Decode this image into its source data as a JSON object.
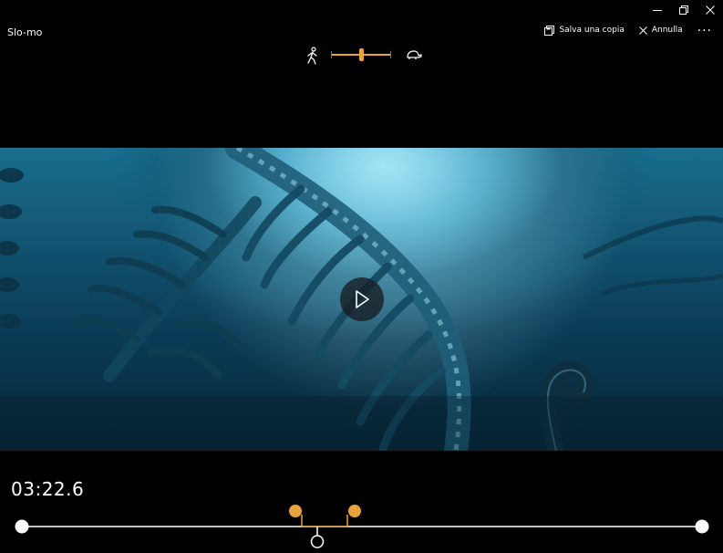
{
  "window": {
    "title": "Slo-mo",
    "controls": {
      "minimize": "minimize-icon",
      "restore": "restore-icon",
      "close": "close-icon"
    }
  },
  "toolbar": {
    "save_copy_label": "Salva una copia",
    "cancel_label": "Annulla",
    "more_label": "..."
  },
  "speed_slider": {
    "left_icon": "walking-person-icon",
    "right_icon": "turtle-icon",
    "level": 0.5,
    "accent": "#e8a33b"
  },
  "player": {
    "play_icon": "play-icon",
    "current_time": "03:22.6"
  },
  "timeline": {
    "range_color": "#e8a33b",
    "track_color": "#ffffff"
  }
}
